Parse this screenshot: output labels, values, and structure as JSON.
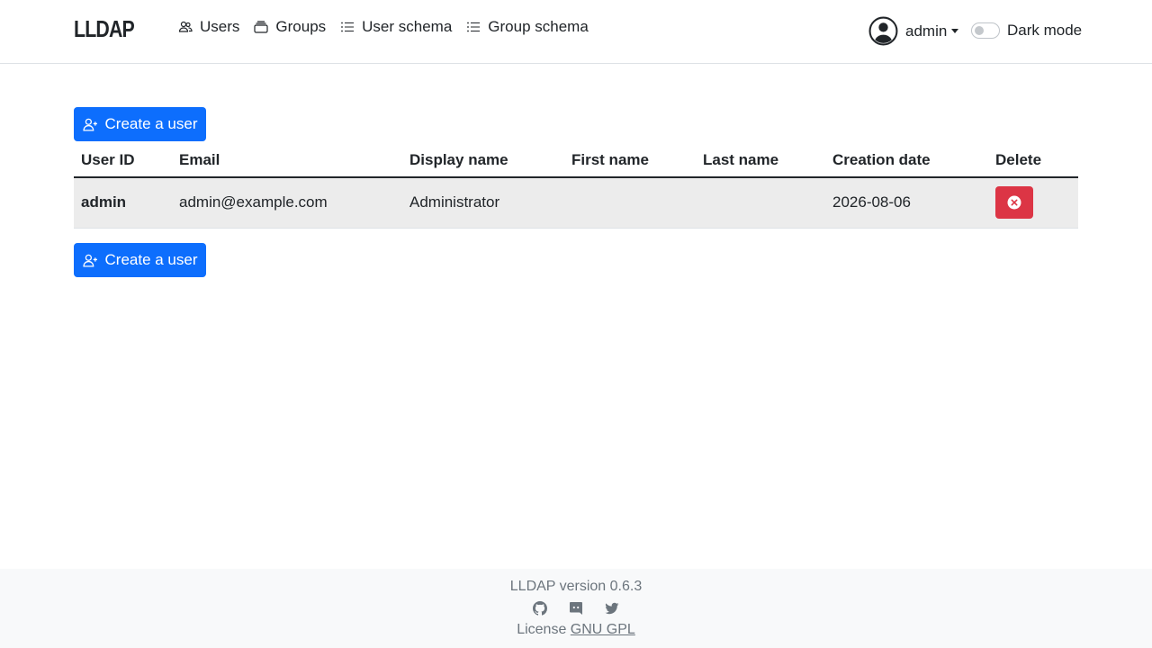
{
  "brand": "LLDAP",
  "nav": {
    "items": [
      {
        "label": "Users",
        "icon": "people-icon"
      },
      {
        "label": "Groups",
        "icon": "collection-icon"
      },
      {
        "label": "User schema",
        "icon": "list-icon"
      },
      {
        "label": "Group schema",
        "icon": "list-icon"
      }
    ]
  },
  "user_menu": {
    "name": "admin"
  },
  "dark_mode": {
    "label": "Dark mode",
    "enabled": false
  },
  "actions": {
    "create_user": "Create a user"
  },
  "table": {
    "columns": [
      "User ID",
      "Email",
      "Display name",
      "First name",
      "Last name",
      "Creation date",
      "Delete"
    ],
    "rows": [
      {
        "user_id": "admin",
        "email": "admin@example.com",
        "display_name": "Administrator",
        "first_name": "",
        "last_name": "",
        "creation_date": "2026-08-06"
      }
    ]
  },
  "footer": {
    "version": "LLDAP version 0.6.3",
    "license_prefix": "License",
    "license_link": "GNU GPL",
    "social_icons": [
      "github-icon",
      "discord-icon",
      "twitter-icon"
    ]
  },
  "colors": {
    "primary": "#0d6efd",
    "danger": "#dc3545",
    "row_bg": "#ececec",
    "footer_bg": "#f8f9fa"
  }
}
